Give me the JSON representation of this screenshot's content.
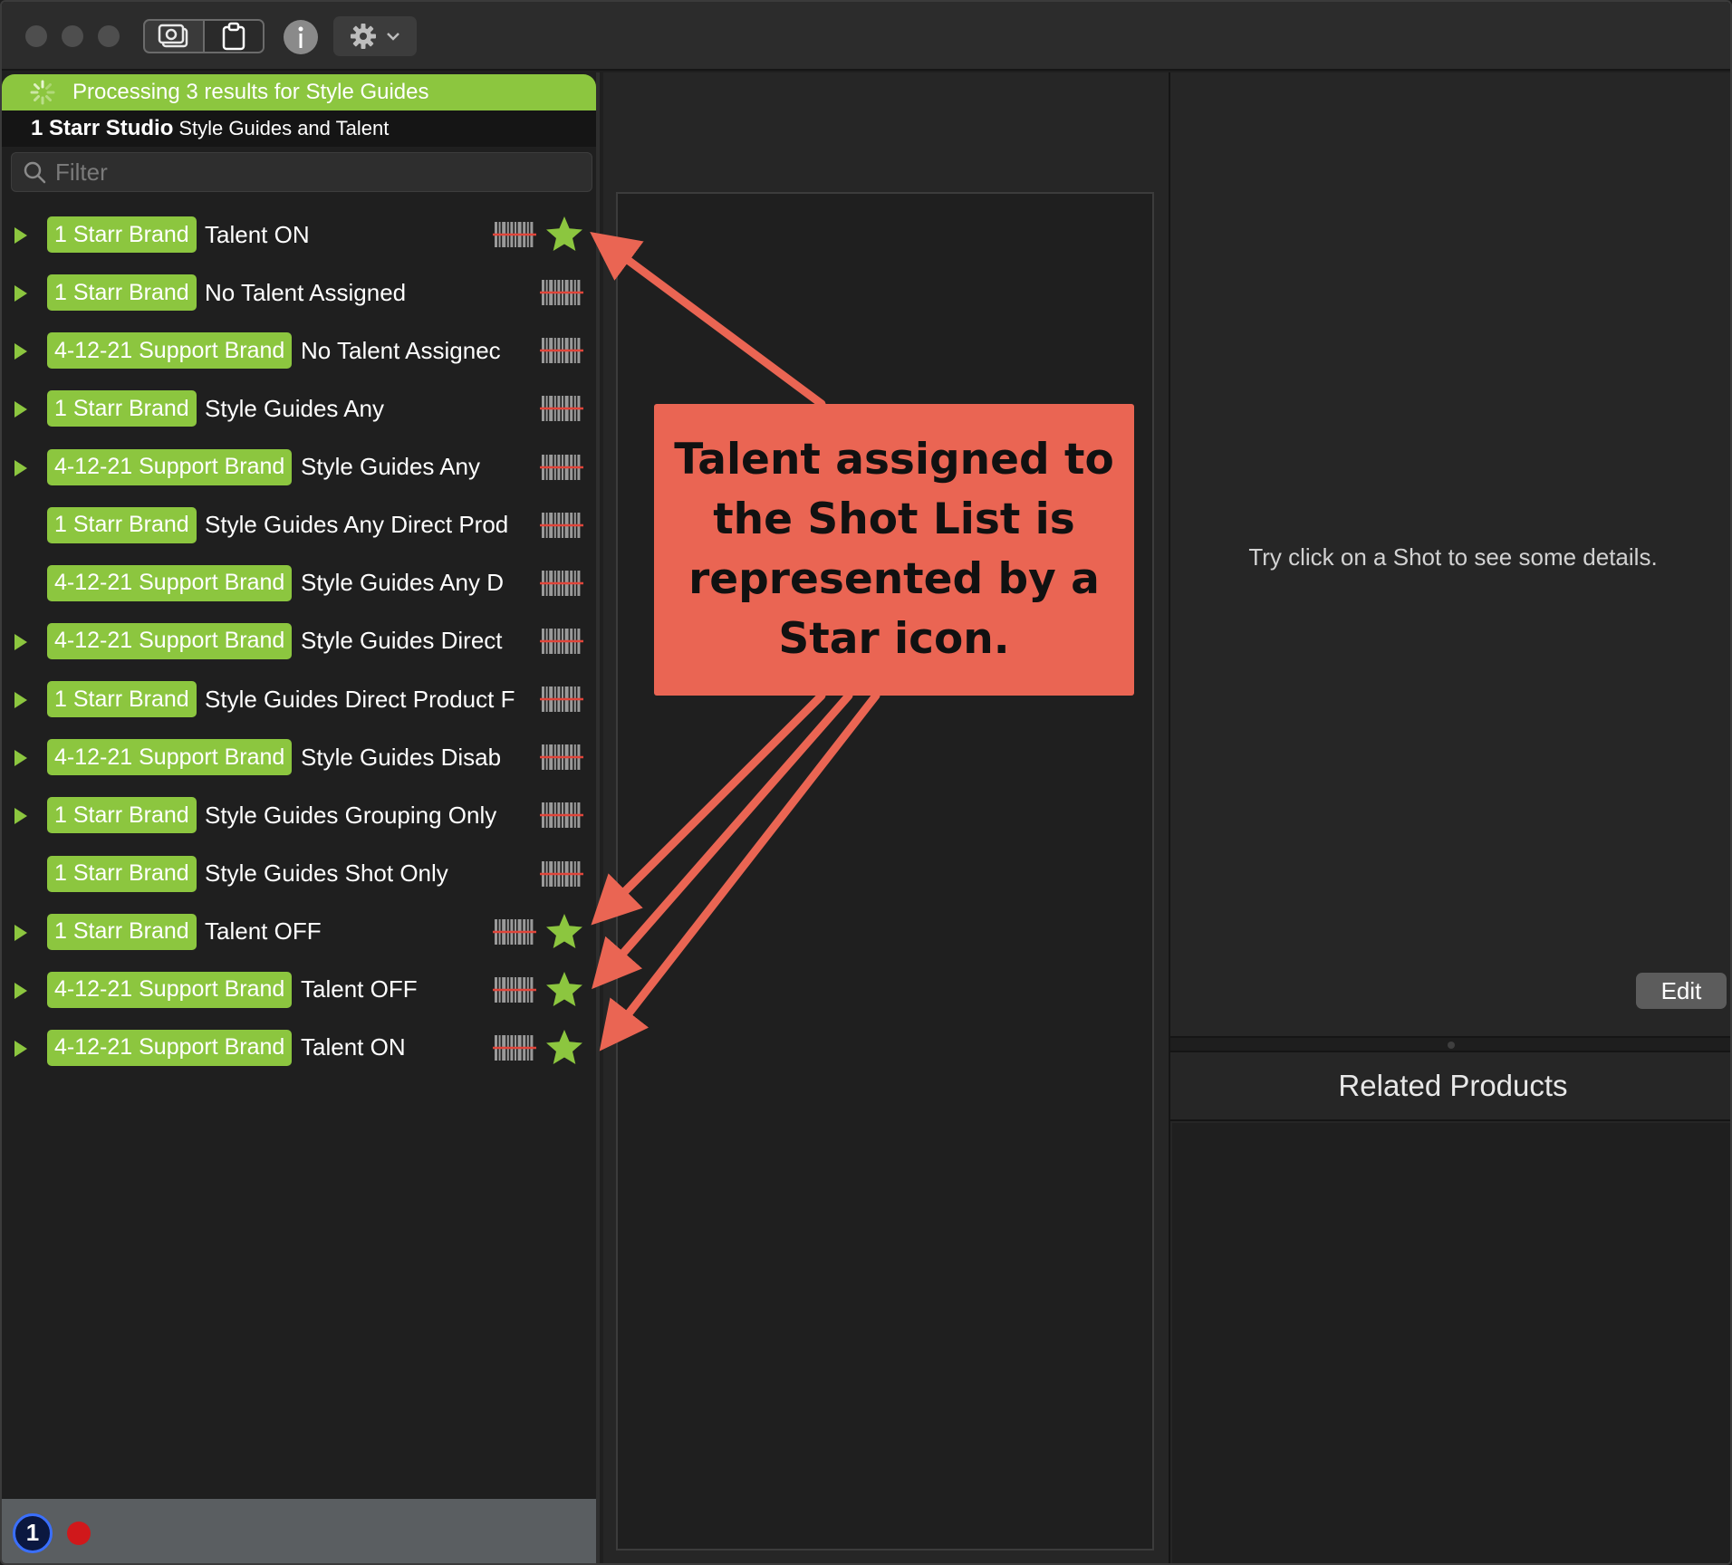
{
  "toolbar": {
    "camera_icon": "camera-icon",
    "clipboard_icon": "clipboard-icon",
    "info_icon": "info-icon",
    "gear_icon": "gear-icon"
  },
  "status": {
    "processing_text": "Processing 3 results for Style Guides"
  },
  "header": {
    "studio_name": "1 Starr Studio",
    "studio_subtitle": "Style Guides and Talent"
  },
  "filter": {
    "placeholder": "Filter",
    "value": ""
  },
  "shots": [
    {
      "brand": "1 Starr Brand",
      "title": "Talent ON",
      "expandable": true,
      "talent": true
    },
    {
      "brand": "1 Starr Brand",
      "title": "No Talent Assigned",
      "expandable": true,
      "talent": false
    },
    {
      "brand": "4-12-21 Support Brand",
      "title": "No Talent Assignec",
      "expandable": true,
      "talent": false
    },
    {
      "brand": "1 Starr Brand",
      "title": "Style Guides Any",
      "expandable": true,
      "talent": false
    },
    {
      "brand": "4-12-21 Support Brand",
      "title": "Style Guides Any",
      "expandable": true,
      "talent": false
    },
    {
      "brand": "1 Starr Brand",
      "title": "Style Guides Any Direct Prod",
      "expandable": false,
      "talent": false
    },
    {
      "brand": "4-12-21 Support Brand",
      "title": "Style Guides Any D",
      "expandable": false,
      "talent": false
    },
    {
      "brand": "4-12-21 Support Brand",
      "title": "Style Guides Direct",
      "expandable": true,
      "talent": false
    },
    {
      "brand": "1 Starr Brand",
      "title": "Style Guides Direct Product F",
      "expandable": true,
      "talent": false
    },
    {
      "brand": "4-12-21 Support Brand",
      "title": "Style Guides Disab",
      "expandable": true,
      "talent": false
    },
    {
      "brand": "1 Starr Brand",
      "title": "Style Guides Grouping Only",
      "expandable": true,
      "talent": false
    },
    {
      "brand": "1 Starr Brand",
      "title": "Style Guides Shot Only",
      "expandable": false,
      "talent": false
    },
    {
      "brand": "1 Starr Brand",
      "title": "Talent OFF",
      "expandable": true,
      "talent": true
    },
    {
      "brand": "4-12-21 Support Brand",
      "title": "Talent OFF",
      "expandable": true,
      "talent": true
    },
    {
      "brand": "4-12-21 Support Brand",
      "title": "Talent ON",
      "expandable": true,
      "talent": true
    }
  ],
  "details": {
    "hint": "Try click on a Shot to see some details.",
    "edit_label": "Edit",
    "related_products_title": "Related Products"
  },
  "annotation": {
    "text": "Talent assigned to the Shot List is represented by a Star icon.",
    "color": "#ea6553"
  },
  "footer": {
    "app_icon_label": "1",
    "app_icon": "1password-icon",
    "record_icon": "record-icon"
  },
  "colors": {
    "brand_green": "#8cc63f",
    "star_green": "#8cc63f",
    "barcode_strike": "#e0453a",
    "annotation_red": "#ea6553"
  }
}
